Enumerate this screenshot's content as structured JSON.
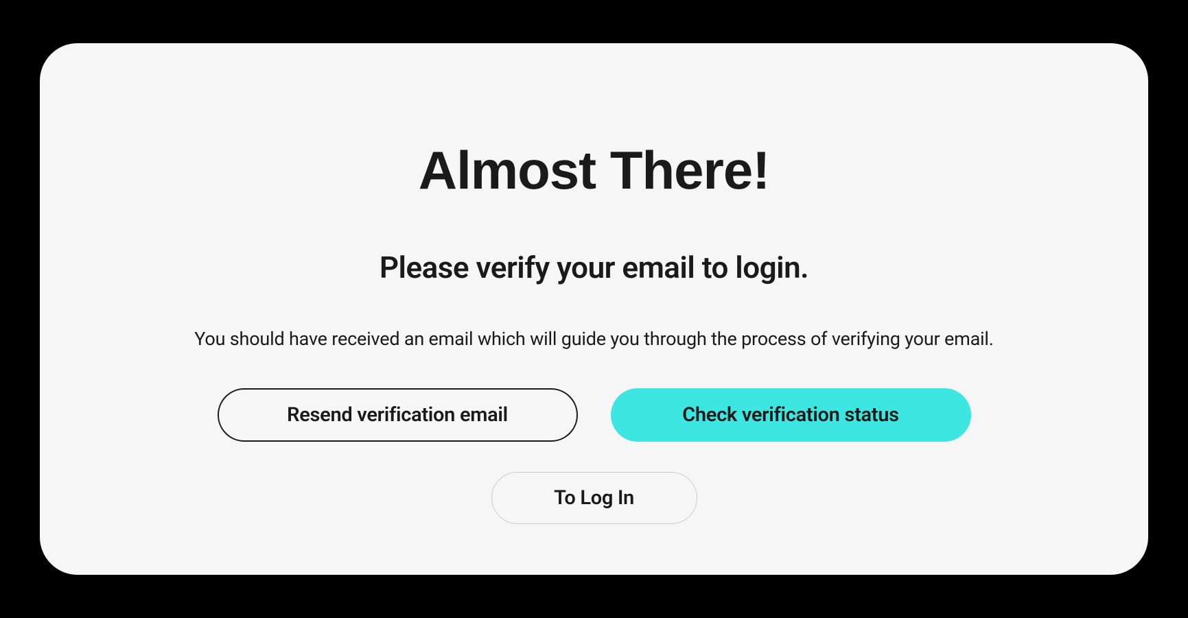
{
  "card": {
    "title": "Almost There!",
    "subtitle": "Please verify your email to login.",
    "description": "You should have received an email which will guide you through the process of verifying your email.",
    "buttons": {
      "resend": "Resend verification email",
      "check": "Check verification status",
      "login": "To Log In"
    }
  },
  "colors": {
    "accent": "#3de6e0",
    "background": "#000000",
    "card_background": "#f6f6f6",
    "text": "#1a1a1a"
  }
}
